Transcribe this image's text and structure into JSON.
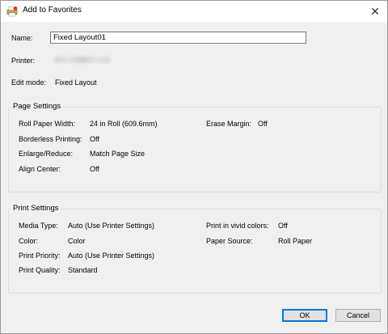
{
  "window": {
    "title": "Add to Favorites",
    "close_symbol": "✕"
  },
  "form": {
    "name_label": "Name:",
    "name_value": "Fixed Layout01",
    "printer_label": "Printer:",
    "edit_mode_label": "Edit mode:",
    "edit_mode_value": "Fixed Layout"
  },
  "page_settings": {
    "title": "Page Settings",
    "roll_paper_width_label": "Roll Paper Width:",
    "roll_paper_width_value": "24 in Roll (609.6mm)",
    "erase_margin_label": "Erase Margin:",
    "erase_margin_value": "Off",
    "borderless_label": "Borderless Printing:",
    "borderless_value": "Off",
    "enlarge_label": "Enlarge/Reduce:",
    "enlarge_value": "Match Page Size",
    "align_center_label": "Align Center:",
    "align_center_value": "Off"
  },
  "print_settings": {
    "title": "Print Settings",
    "media_type_label": "Media Type:",
    "media_type_value": "Auto (Use Printer Settings)",
    "vivid_label": "Print in vivid colors:",
    "vivid_value": "Off",
    "color_label": "Color:",
    "color_value": "Color",
    "paper_source_label": "Paper Source:",
    "paper_source_value": "Roll Paper",
    "priority_label": "Print Priority:",
    "priority_value": "Auto (Use Printer Settings)",
    "quality_label": "Print Quality:",
    "quality_value": "Standard"
  },
  "buttons": {
    "ok": "OK",
    "cancel": "Cancel"
  },
  "icons": {
    "app": "favorites-printer-icon",
    "close": "close-icon"
  },
  "colors": {
    "accent": "#0078d7",
    "dialog_bg": "#f0f0f0",
    "titlebar_bg": "#ffffff"
  }
}
